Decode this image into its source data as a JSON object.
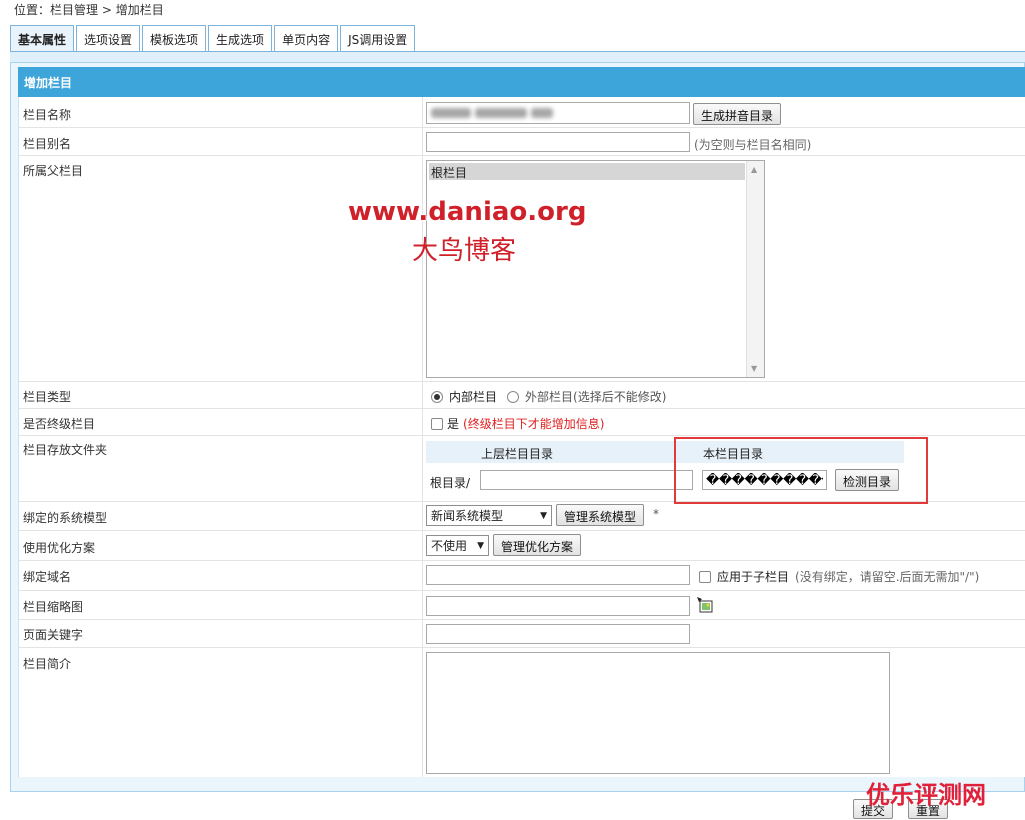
{
  "breadcrumb": {
    "prefix": "位置：",
    "link": "栏目管理",
    "separator": " > ",
    "current": "增加栏目"
  },
  "tabs": [
    {
      "label": "基本属性",
      "active": true
    },
    {
      "label": "选项设置"
    },
    {
      "label": "模板选项"
    },
    {
      "label": "生成选项"
    },
    {
      "label": "单页内容"
    },
    {
      "label": "JS调用设置"
    }
  ],
  "header": {
    "title": "增加栏目"
  },
  "fields": {
    "name": {
      "label": "栏目名称",
      "button": "生成拼音目录"
    },
    "alias": {
      "label": "栏目别名",
      "hint": "(为空则与栏目名相同)"
    },
    "parent": {
      "label": "所属父栏目",
      "option": "根栏目"
    },
    "type": {
      "label": "栏目类型",
      "opt1": "内部栏目",
      "opt2": "外部栏目(选择后不能修改)"
    },
    "final": {
      "label": "是否终级栏目",
      "checkbox": "是",
      "hint": "(终级栏目下才能增加信息)"
    },
    "folder": {
      "label": "栏目存放文件夹",
      "col1": "上层栏目目录",
      "col2": "本栏目目录",
      "root": "根目录/",
      "current_value": "����������",
      "button": "检测目录"
    },
    "model": {
      "label": "绑定的系统模型",
      "selected": "新闻系统模型",
      "button": "管理系统模型",
      "star": "*"
    },
    "optimize": {
      "label": "使用优化方案",
      "selected": "不使用",
      "button": "管理优化方案"
    },
    "domain": {
      "label": "绑定域名",
      "checkbox": "应用于子栏目",
      "hint": "(没有绑定，请留空.后面无需加\"/\")"
    },
    "thumb": {
      "label": "栏目缩略图"
    },
    "keywords": {
      "label": "页面关键字"
    },
    "intro": {
      "label": "栏目简介"
    }
  },
  "footer": {
    "submit": "提交",
    "reset": "重置"
  },
  "watermarks": {
    "site": "www.daniao.org",
    "blog": "大鸟博客",
    "corner": "优乐评测网"
  },
  "colors": {
    "header_bar": "#3ea5db",
    "highlight_box": "#e13a3a",
    "watermark": "#d0202a"
  }
}
